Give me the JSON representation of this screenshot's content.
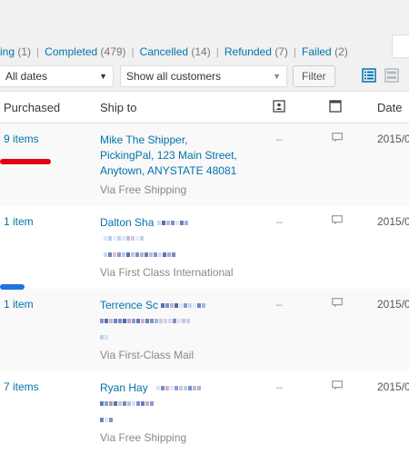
{
  "filters": [
    {
      "label": "ing",
      "count": "(1)"
    },
    {
      "label": "Completed",
      "count": "(479)"
    },
    {
      "label": "Cancelled",
      "count": "(14)"
    },
    {
      "label": "Refunded",
      "count": "(7)"
    },
    {
      "label": "Failed",
      "count": "(2)"
    }
  ],
  "separator": "|",
  "toolbar": {
    "dates_value": "All dates",
    "customers_value": "Show all customers",
    "filter_label": "Filter"
  },
  "columns": {
    "purchased": "Purchased",
    "ship_to": "Ship to",
    "date": "Date"
  },
  "orders": [
    {
      "purchased": "9 items",
      "name": "Mike The Shipper,",
      "line2": "PickingPal, 123 Main Street,",
      "line3": "Anytown, ANYSTATE 48081",
      "via": "Via Free Shipping",
      "dash": "–",
      "date": "2015/0"
    },
    {
      "purchased": "1 item",
      "name": "Dalton Sha",
      "line2": "",
      "line3": "",
      "via": "Via First Class International",
      "dash": "–",
      "date": "2015/0"
    },
    {
      "purchased": "1 item",
      "name": "Terrence Sc",
      "line2": "",
      "line3": "",
      "via": "Via First-Class Mail",
      "dash": "–",
      "date": "2015/0"
    },
    {
      "purchased": "7 items",
      "name": "Ryan Hay",
      "line2": "",
      "line3": "",
      "via": "Via Free Shipping",
      "dash": "–",
      "date": "2015/0"
    }
  ],
  "colors": {
    "link": "#0073aa",
    "red_marker": "#e40012",
    "blue_marker": "#1f74e0"
  }
}
